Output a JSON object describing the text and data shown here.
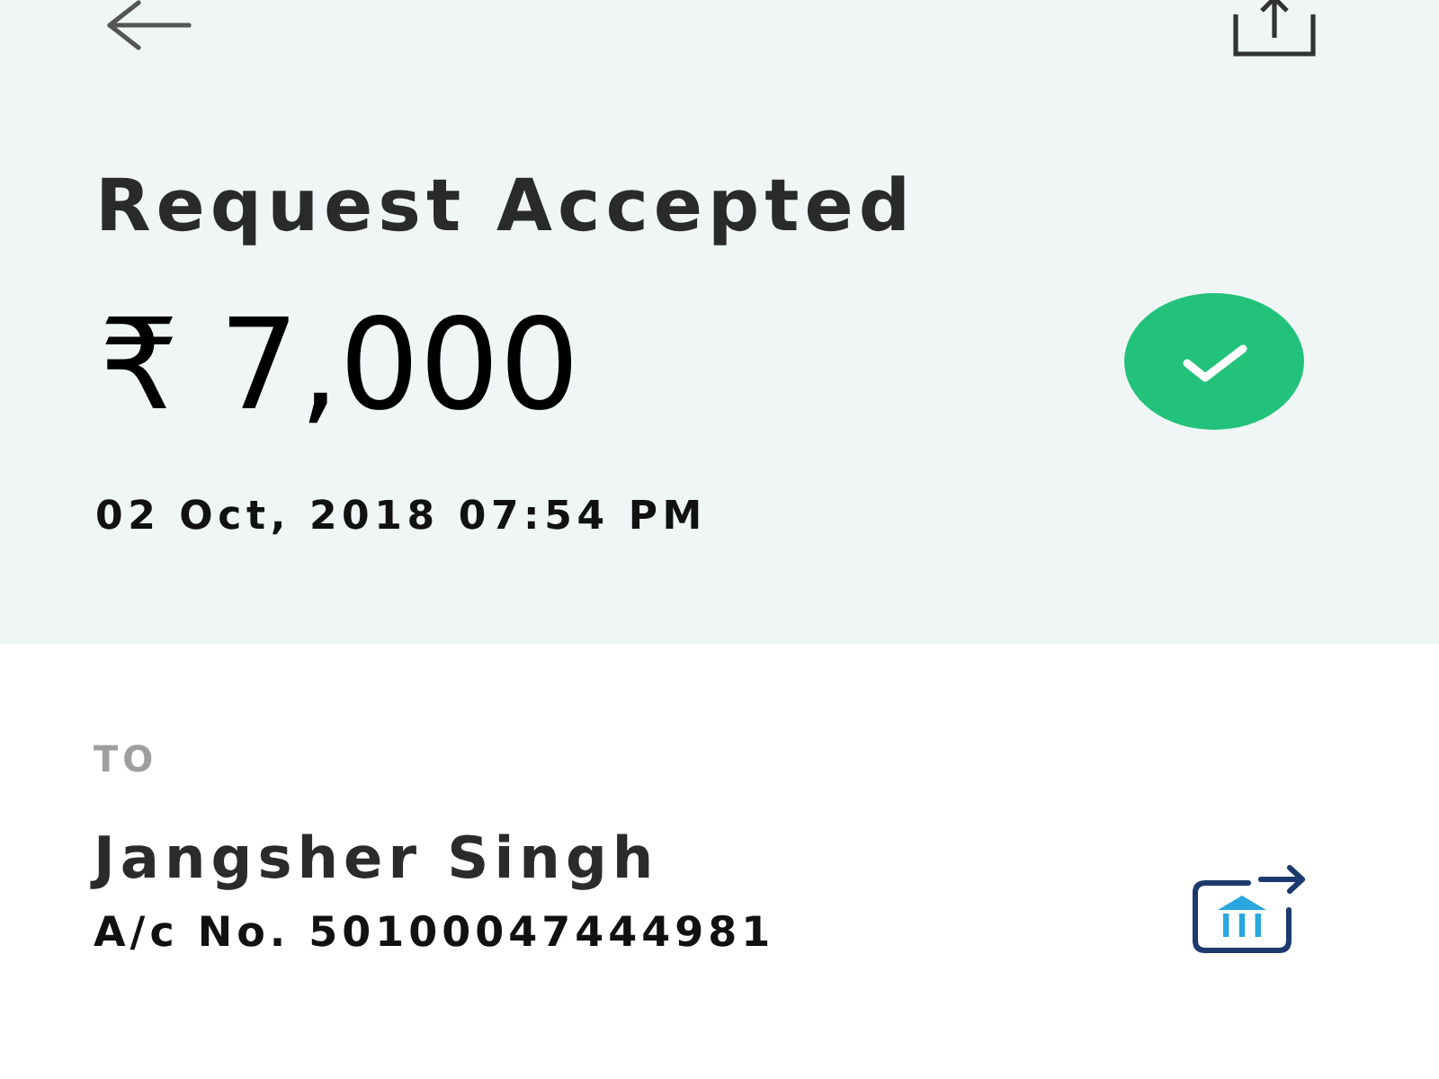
{
  "summary": {
    "title": "Request Accepted",
    "amount": "₹ 7,000",
    "accepted": true,
    "timestamp": "02 Oct, 2018 07:54 PM"
  },
  "recipient": {
    "label": "TO",
    "name": "Jangsher Singh",
    "account": "A/c No. 50100047444981"
  }
}
